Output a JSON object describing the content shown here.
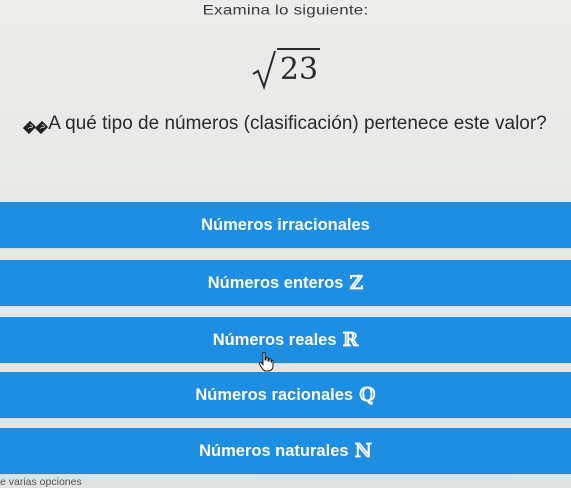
{
  "instruction": "Examina lo siguiente:",
  "expression": {
    "radical_symbol": "√",
    "radicand": "23"
  },
  "question": {
    "garbled_prefix": "��",
    "text": "A qué tipo de números (clasificación) pertenece este valor?"
  },
  "options": [
    {
      "label": "Números irracionales",
      "symbol": ""
    },
    {
      "label": "Números enteros",
      "symbol": "ℤ"
    },
    {
      "label": "Números reales",
      "symbol": "ℝ"
    },
    {
      "label": "Números racionales",
      "symbol": "ℚ"
    },
    {
      "label": "Números naturales",
      "symbol": "ℕ"
    }
  ],
  "footer_hint": "e varias opciones",
  "colors": {
    "option_background": "#1d8ee1",
    "option_text": "#ffffff",
    "page_background": "#e9ebe8"
  },
  "icons": {
    "cursor": "hand-pointer-icon"
  }
}
